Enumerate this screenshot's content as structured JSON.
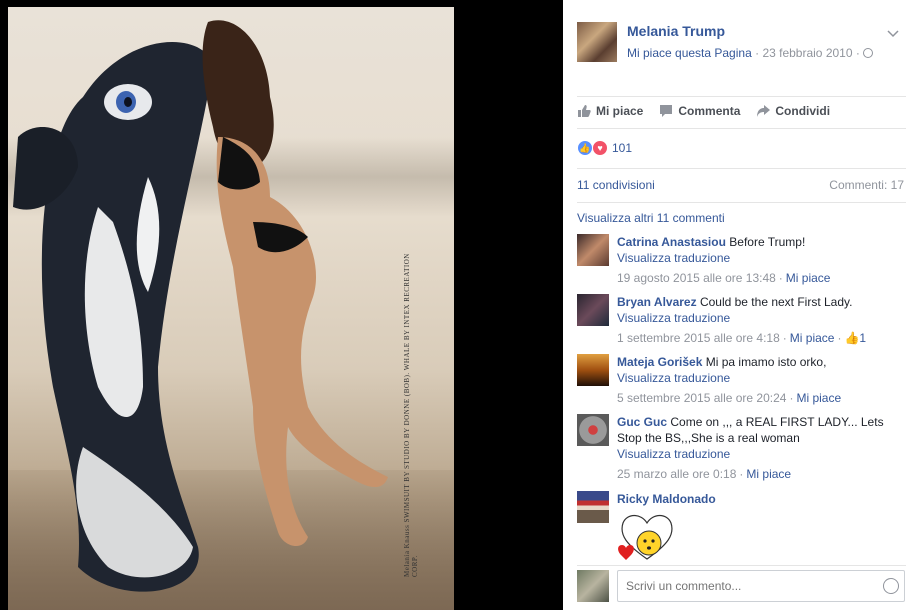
{
  "photo": {
    "caption": "Melania Knauss SWIMSUIT BY STUDIO BY DONNE (BOB). WHALE BY INTEX RECREATION CORP."
  },
  "post": {
    "page_name": "Melania Trump",
    "like_page": "Mi piace questa Pagina",
    "separator": "·",
    "date": "23 febbraio 2010",
    "visibility_icon": "globe-icon"
  },
  "actions": {
    "like": "Mi piace",
    "comment": "Commenta",
    "share": "Condividi"
  },
  "reactions": {
    "count": "101",
    "types": [
      "like",
      "love"
    ]
  },
  "stats": {
    "shares": "11 condivisioni",
    "comments": "Commenti: 17"
  },
  "view_more": "Visualizza altri 11 commenti",
  "comments": [
    {
      "author": "Catrina Anastasiou",
      "text": "Before Trump!",
      "link": "Visualizza traduzione",
      "time": "19 agosto 2015 alle ore 13:48",
      "like": "Mi piace"
    },
    {
      "author": "Bryan Alvarez",
      "text": "Could be the next First Lady.",
      "link": "Visualizza traduzione",
      "time": "1 settembre 2015 alle ore 4:18",
      "like": "Mi piace",
      "likes": "1"
    },
    {
      "author": "Mateja Gorišek",
      "text": "Mi pa imamo isto orko,",
      "link": "Visualizza traduzione",
      "time": "5 settembre 2015 alle ore 20:24",
      "like": "Mi piace"
    },
    {
      "author": "Guc Guc",
      "text": "Come on ,,, a REAL FIRST LADY... Lets Stop the BS,,,She is a real woman",
      "link": "Visualizza traduzione",
      "time": "25 marzo alle ore 0:18",
      "like": "Mi piace"
    },
    {
      "author": "Ricky Maldonado",
      "sticker": "heart-smiley-sticker"
    }
  ],
  "reply": {
    "placeholder": "Scrivi un commento..."
  },
  "colors": {
    "link": "#365899",
    "meta": "#90949c",
    "like_blue": "#5890ff",
    "love_red": "#f25268"
  }
}
